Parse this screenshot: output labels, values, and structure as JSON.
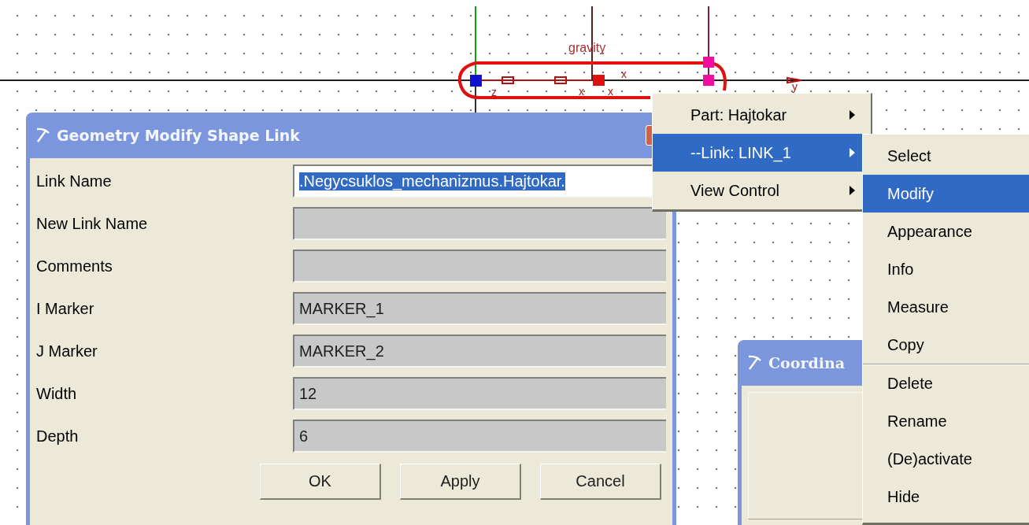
{
  "canvas": {
    "labels": [
      {
        "kind": "title",
        "text": "gravity"
      },
      {
        "kind": "axis",
        "text": "z"
      },
      {
        "kind": "axis",
        "text": "x"
      },
      {
        "kind": "axis",
        "text": "x"
      },
      {
        "kind": "axis",
        "text": "x"
      },
      {
        "kind": "axis",
        "text": "y"
      }
    ]
  },
  "dialogs": [
    {
      "title": "Geometry Modify Shape Link",
      "fields": [
        {
          "label": "Link Name",
          "value": ".Negycsuklos_mechanizmus.Hajtokar.",
          "text_selected": true,
          "editable": true
        },
        {
          "label": "New Link Name",
          "editable": false
        },
        {
          "label": "Comments",
          "editable": false
        },
        {
          "label": "I Marker",
          "value": "MARKER_1",
          "text_selected": false,
          "editable": false
        },
        {
          "label": "J Marker",
          "value": "MARKER_2",
          "text_selected": false,
          "editable": false
        },
        {
          "label": "Width",
          "value": "12",
          "text_selected": false,
          "editable": false
        },
        {
          "label": "Depth",
          "value": "6",
          "text_selected": false,
          "editable": false
        }
      ],
      "buttons": [
        "OK",
        "Apply",
        "Cancel"
      ]
    },
    {
      "title": "Coordina"
    }
  ],
  "context_menu": {
    "items": [
      {
        "label": "Part: Hajtokar",
        "has_submenu": true,
        "selected": false
      },
      {
        "label": "--Link: LINK_1",
        "has_submenu": true,
        "selected": true
      },
      {
        "label": "View Control",
        "has_submenu": true,
        "selected": false
      }
    ]
  },
  "submenu": {
    "items": [
      {
        "label": "Select",
        "selected": false,
        "separator_before": false
      },
      {
        "label": "Modify",
        "selected": true,
        "separator_before": false
      },
      {
        "label": "Appearance",
        "selected": false,
        "separator_before": false
      },
      {
        "label": "Info",
        "selected": false,
        "separator_before": false
      },
      {
        "label": "Measure",
        "selected": false,
        "separator_before": false
      },
      {
        "label": "Copy",
        "selected": false,
        "separator_before": false
      },
      {
        "label": "Delete",
        "selected": false,
        "separator_before": true
      },
      {
        "label": "Rename",
        "selected": false,
        "separator_before": false
      },
      {
        "label": "(De)activate",
        "selected": false,
        "separator_before": false
      },
      {
        "label": "Hide",
        "selected": false,
        "separator_before": false
      }
    ]
  }
}
